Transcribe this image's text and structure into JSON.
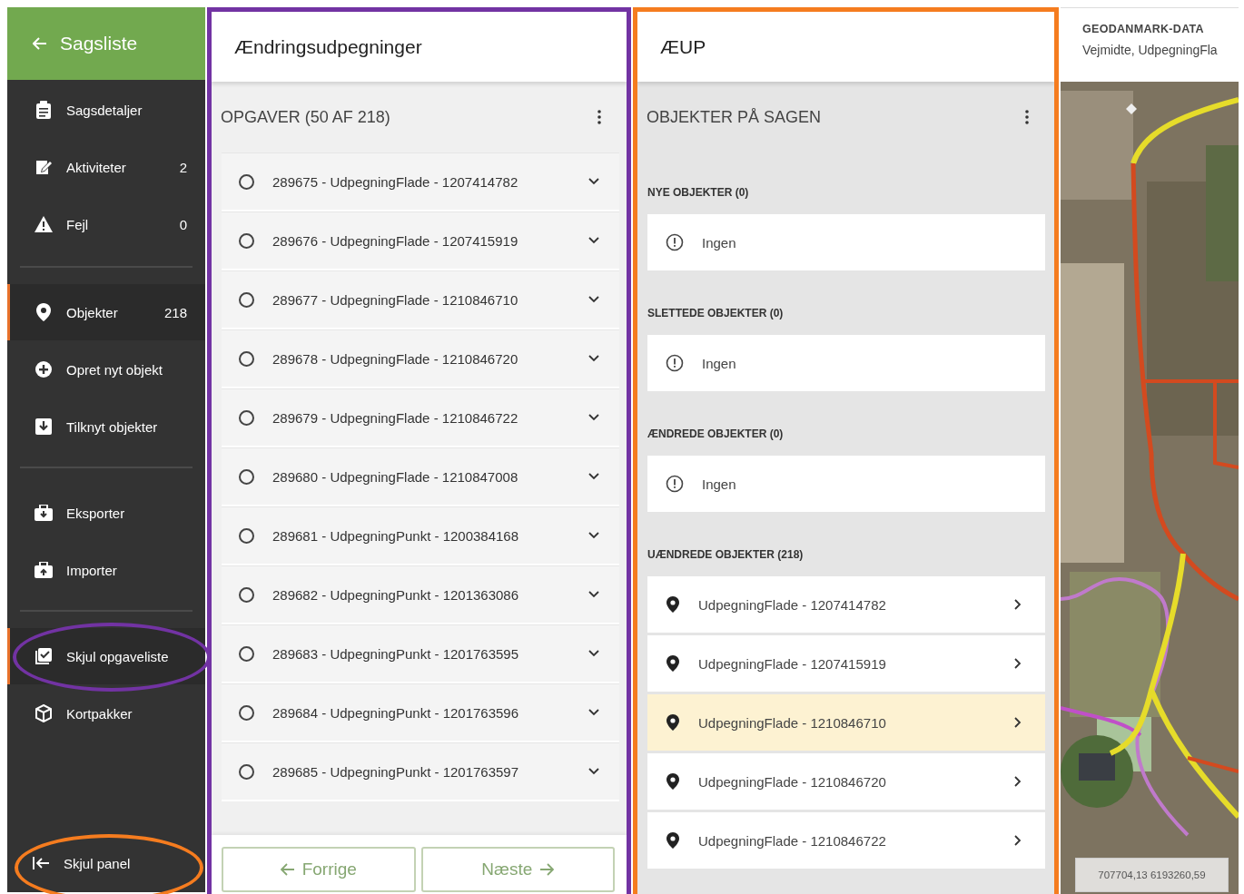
{
  "sidebar": {
    "back": {
      "label": "Sagsliste"
    },
    "groups": [
      {
        "items": [
          {
            "label": "Sagsdetaljer",
            "selected": false,
            "circled": false
          },
          {
            "label": "Aktiviteter",
            "count": "2",
            "selected": false,
            "circled": false
          },
          {
            "label": "Fejl",
            "count": "0",
            "selected": false,
            "circled": false
          }
        ]
      },
      {
        "items": [
          {
            "label": "Objekter",
            "count": "218",
            "selected": true,
            "circled": false
          },
          {
            "label": "Opret nyt objekt",
            "selected": false,
            "circled": false
          },
          {
            "label": "Tilknyt objekter",
            "selected": false,
            "circled": false
          }
        ]
      },
      {
        "items": [
          {
            "label": "Eksporter",
            "selected": false,
            "circled": false
          },
          {
            "label": "Importer",
            "selected": false,
            "circled": false
          }
        ]
      },
      {
        "items": [
          {
            "label": "Skjul opgaveliste",
            "selected": true,
            "circled": true,
            "color": "#7233a3"
          },
          {
            "label": "Kortpakker",
            "selected": false,
            "circled": false
          }
        ]
      }
    ],
    "footer": {
      "label": "Skjul panel",
      "circled": true,
      "color": "#f57c1f"
    }
  },
  "task_panel": {
    "color": "#7233a3",
    "title": "Ændringsudpegninger",
    "list_title": "OPGAVER (50 AF 218)",
    "tasks": [
      {
        "label": "289675 - UdpegningFlade - 1207414782",
        "checked": false,
        "expanded": false
      },
      {
        "label": "289676 - UdpegningFlade - 1207415919",
        "checked": false,
        "expanded": false
      },
      {
        "label": "289677 - UdpegningFlade - 1210846710",
        "checked": false,
        "expanded": false
      },
      {
        "label": "289678 - UdpegningFlade - 1210846720",
        "checked": false,
        "expanded": false
      },
      {
        "label": "289679 - UdpegningFlade - 1210846722",
        "checked": false,
        "expanded": false
      },
      {
        "label": "289680 - UdpegningFlade - 1210847008",
        "checked": false,
        "expanded": false
      },
      {
        "label": "289681 - UdpegningPunkt - 1200384168",
        "checked": false,
        "expanded": false
      },
      {
        "label": "289682 - UdpegningPunkt - 1201363086",
        "checked": false,
        "expanded": false
      },
      {
        "label": "289683 - UdpegningPunkt - 1201763595",
        "checked": false,
        "expanded": false
      },
      {
        "label": "289684 - UdpegningPunkt - 1201763596",
        "checked": false,
        "expanded": false
      },
      {
        "label": "289685 - UdpegningPunkt - 1201763597",
        "checked": false,
        "expanded": false
      }
    ],
    "buttons": [
      {
        "label": "Forrige",
        "kind": "previous"
      },
      {
        "label": "Næste",
        "kind": "next"
      }
    ]
  },
  "objects_panel": {
    "color": "#f57c1f",
    "title": "ÆUP",
    "list_title": "OBJEKTER PÅ SAGEN",
    "sections": [
      {
        "title": "NYE OBJEKTER (0)",
        "items": [
          {
            "kind": "empty",
            "label": "Ingen",
            "selected": false
          }
        ]
      },
      {
        "title": "SLETTEDE OBJEKTER (0)",
        "items": [
          {
            "kind": "empty",
            "label": "Ingen",
            "selected": false
          }
        ]
      },
      {
        "title": "ÆNDREDE OBJEKTER (0)",
        "items": [
          {
            "kind": "empty",
            "label": "Ingen",
            "selected": false
          }
        ]
      },
      {
        "title": "UÆNDREDE OBJEKTER (218)",
        "items": [
          {
            "kind": "object",
            "label": "UdpegningFlade - 1207414782",
            "selected": false
          },
          {
            "kind": "object",
            "label": "UdpegningFlade - 1207415919",
            "selected": false
          },
          {
            "kind": "object",
            "label": "UdpegningFlade - 1210846710",
            "selected": true
          },
          {
            "kind": "object",
            "label": "UdpegningFlade - 1210846720",
            "selected": false
          },
          {
            "kind": "object",
            "label": "UdpegningFlade - 1210846722",
            "selected": false
          }
        ]
      }
    ]
  },
  "map": {
    "layer_title": "GEODANMARK-DATA",
    "layer_subtitle": "Vejmidte, UdpegningFla",
    "coordinates": "707704,13 6193260,59"
  }
}
